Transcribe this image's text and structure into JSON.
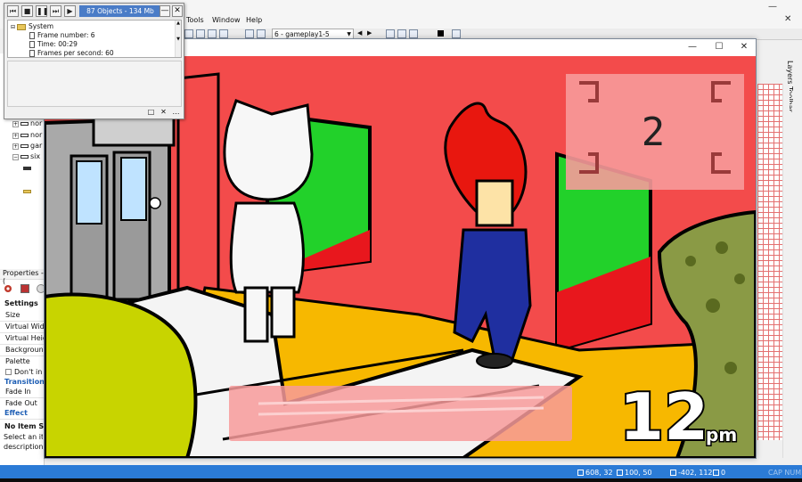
{
  "ide": {
    "menus": [
      "Tools",
      "Window",
      "Help"
    ],
    "frame_select": "6 - gameplay1-5",
    "left_tree": [
      "nor",
      "nor",
      "gar",
      "six"
    ],
    "properties_title": "Properties - (",
    "settings_label": "Settings",
    "props": [
      "Size",
      "Virtual Widt",
      "Virtual Heig",
      "Backgroun",
      "Palette",
      "Don't in"
    ],
    "transitions_label": "Transitions",
    "trans_props": [
      "Fade In",
      "Fade Out"
    ],
    "effect_label": "Effect",
    "no_item_title": "No Item Sel",
    "no_item_desc_1": "Select an iter",
    "no_item_desc_2": "description",
    "layers_toolbar": "Layers Toolbar"
  },
  "debugger": {
    "status": "87 Objects - 134 Mb",
    "tree_root": "System",
    "rows": [
      "Frame number: 6",
      "Time: 00:29",
      "Frames per second: 60"
    ]
  },
  "game": {
    "counter": "2",
    "clock_hour": "12",
    "clock_suffix": "pm"
  },
  "statusbar": {
    "pos1": "608, 32",
    "pos2": "100, 50",
    "pos3": "-402, 112",
    "count": "0",
    "caps": "CAP NUM"
  },
  "colors": {
    "accent_blue": "#2b7bd6",
    "wall_red": "#f34b4b",
    "floor_orange": "#f7b800"
  }
}
